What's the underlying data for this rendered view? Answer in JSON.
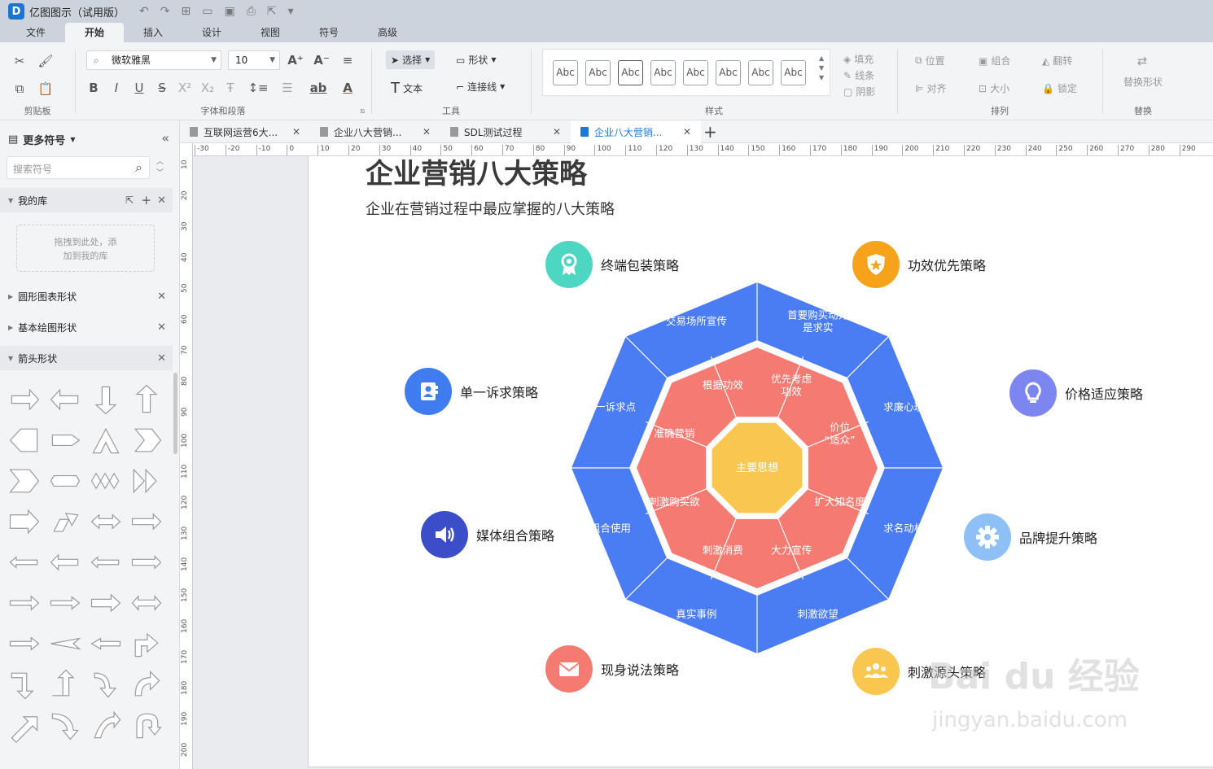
{
  "app": {
    "title": "亿图图示（试用版）"
  },
  "menu": [
    "文件",
    "开始",
    "插入",
    "设计",
    "视图",
    "符号",
    "高级"
  ],
  "active_menu": "开始",
  "ribbon": {
    "clipboard_label": "剪贴板",
    "font": {
      "family": "微软雅黑",
      "size": "10",
      "group_label": "字体和段落"
    },
    "tools": {
      "select": "选择",
      "shape": "形状",
      "text": "文本",
      "connector": "连接线",
      "group_label": "工具"
    },
    "styles": {
      "sample": "Abc",
      "group_label": "样式",
      "fill": "填充",
      "line": "线条",
      "shadow": "阴影"
    },
    "arrange": {
      "position": "位置",
      "group": "组合",
      "flip": "翻转",
      "align": "对齐",
      "size": "大小",
      "lock": "锁定",
      "group_label": "排列"
    },
    "replace": {
      "button": "替换形状",
      "group_label": "替换"
    }
  },
  "left_panel": {
    "title": "更多符号",
    "search_placeholder": "搜索符号",
    "my_library": "我的库",
    "drop_hint_1": "拖拽到此处，添",
    "drop_hint_2": "加到我的库",
    "libraries": [
      "圆形图表形状",
      "基本绘图形状",
      "箭头形状"
    ]
  },
  "doc_tabs": [
    "互联网运营6大...",
    "企业八大营销...",
    "SDL测试过程",
    "企业八大营销..."
  ],
  "ruler": {
    "h": [
      "-30",
      "-20",
      "-10",
      "0",
      "10",
      "20",
      "30",
      "40",
      "50",
      "60",
      "70",
      "80",
      "90",
      "100",
      "110",
      "120",
      "130",
      "140",
      "150",
      "160",
      "170",
      "180",
      "190",
      "200",
      "210",
      "220",
      "230",
      "240",
      "250",
      "260",
      "270",
      "280",
      "290"
    ],
    "v": [
      "10",
      "20",
      "30",
      "40",
      "50",
      "60",
      "70",
      "80",
      "90",
      "100",
      "110",
      "120",
      "130",
      "140",
      "150",
      "160",
      "170",
      "180",
      "190",
      "200"
    ]
  },
  "diagram": {
    "title": "企业营销八大策略",
    "subtitle": "企业在营销过程中最应掌握的八大策略",
    "center": "主要思想",
    "outer_segments": [
      "首要购买动力\n是求实",
      "求廉心理",
      "求名动机",
      "刺激欲望",
      "真实事例",
      "组合使用",
      "单一诉求点",
      "交易场所宣传"
    ],
    "inner_segments": [
      "优先考虑\n功效",
      "价位\n“适众”",
      "扩大知名度",
      "大力宣传",
      "刺激消费",
      "刺激购买欲",
      "准确营销",
      "根据功效"
    ],
    "colors": {
      "outer": "#4a7cf3",
      "inner": "#f57b72",
      "center": "#f9c74f"
    },
    "strategies": [
      {
        "label": "终端包装策略",
        "color": "#4dd6c1",
        "icon": "award-icon"
      },
      {
        "label": "功效优先策略",
        "color": "#f7a21b",
        "icon": "shield-star-icon"
      },
      {
        "label": "单一诉求策略",
        "color": "#3f7cf0",
        "icon": "contact-book-icon"
      },
      {
        "label": "价格适应策略",
        "color": "#7d86f0",
        "icon": "lightbulb-icon"
      },
      {
        "label": "媒体组合策略",
        "color": "#3b4dc9",
        "icon": "speaker-icon"
      },
      {
        "label": "品牌提升策略",
        "color": "#8ec0f5",
        "icon": "gear-icon"
      },
      {
        "label": "现身说法策略",
        "color": "#f57b72",
        "icon": "mail-icon"
      },
      {
        "label": "刺激源头策略",
        "color": "#f9c74f",
        "icon": "group-icon"
      }
    ]
  },
  "watermark": {
    "text": "Bai du 经验",
    "url": "jingyan.baidu.com"
  }
}
